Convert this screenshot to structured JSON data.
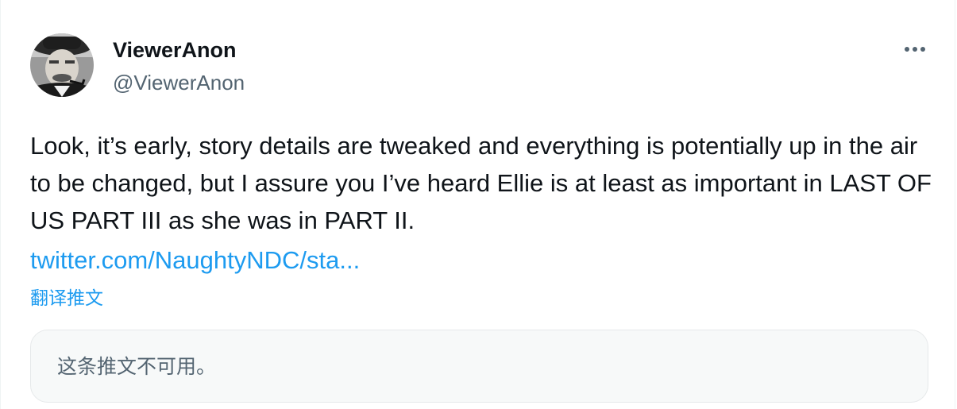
{
  "tweet": {
    "display_name": "ViewerAnon",
    "handle": "@ViewerAnon",
    "body": "Look, it’s early, story details are tweaked and everything is potentially up in the air to be changed, but I assure you I’ve heard Ellie is at least as important in LAST OF US PART III as she was in PART II.",
    "link_text": "twitter.com/NaughtyNDC/sta...",
    "translate_label": "翻译推文",
    "quoted_unavailable": "这条推文不可用。"
  },
  "icons": {
    "more": "more-horizontal-icon",
    "avatar": "avatar-photo"
  },
  "colors": {
    "link": "#1d9bf0",
    "text_primary": "#0f1419",
    "text_secondary": "#536471",
    "quote_bg": "#f7f9f9"
  }
}
